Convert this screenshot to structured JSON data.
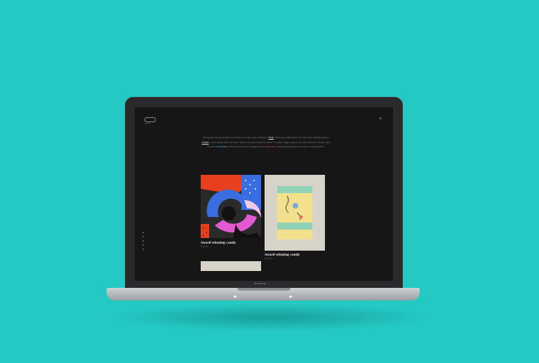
{
  "colors": {
    "background": "#25c9c4",
    "screen": "#161616",
    "accent_blue": "#4aa3d8",
    "accent_red": "#e04a3a"
  },
  "header": {
    "logo_label": "OPAL",
    "menu_icon": "close-icon"
  },
  "intro": {
    "part1": "During the first presentation to Munich, we were also working in",
    "link1": "Paris",
    "part2": ", which was distributed from the world headquarters in",
    "link2": "Seattle",
    "part3": ". Lorem ipsum dolor sit amet, sed do eiusmod tempor ut labore et dolore magna aliqua. Ut enim ad minim veniam, quis nostrud",
    "link3": "exercitation",
    "part4": "ullamco laboris nisi ut aliquip ex ea",
    "link4": "commodo",
    "part5": "consequat duis aute irure dolor in reprehenderit."
  },
  "side_nav": {
    "dots": 5
  },
  "cards": [
    {
      "title": "Award winning candy",
      "subtitle": "Illustration"
    },
    {
      "title": "Award winning candy",
      "subtitle": "Illustration"
    }
  ],
  "laptop": {
    "brand": "MacBook"
  }
}
